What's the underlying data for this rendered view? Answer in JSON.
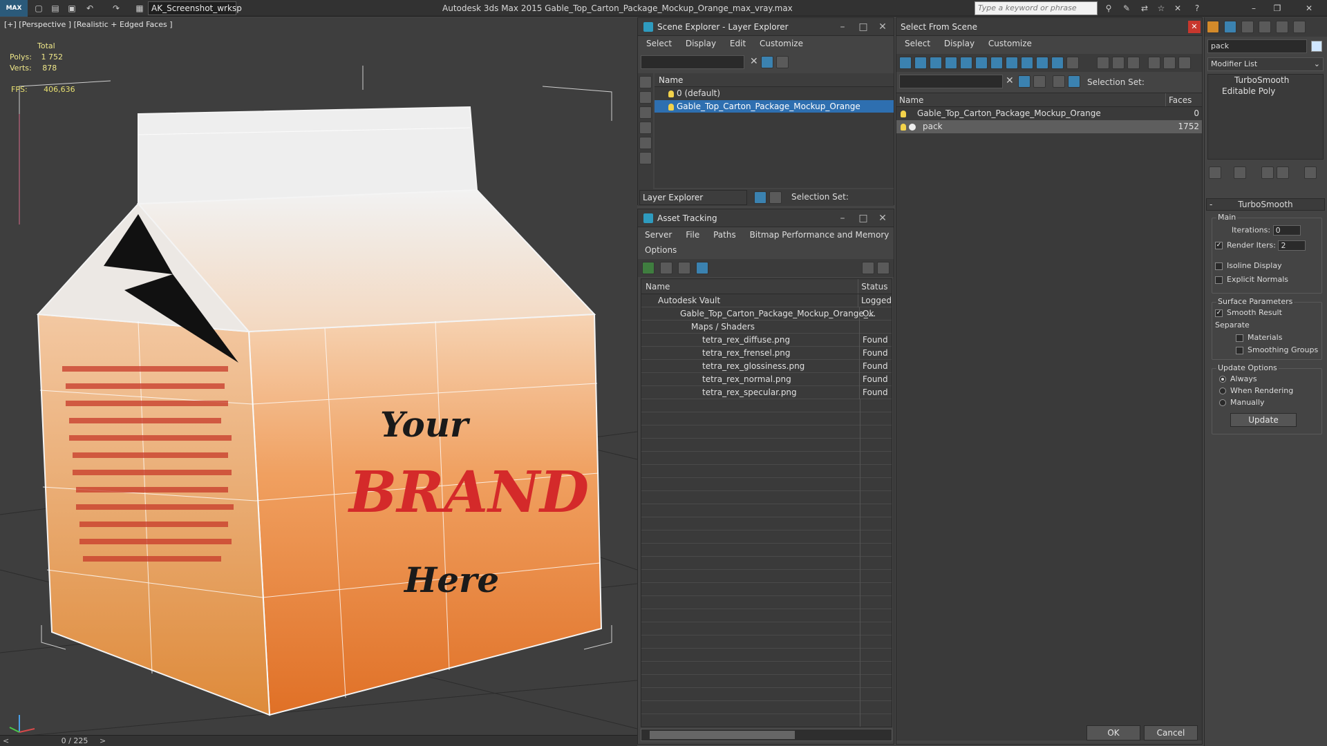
{
  "app": {
    "logo": "MAX",
    "workspace": "AK_Screenshot_wrksp",
    "title": "Autodesk 3ds Max  2015    Gable_Top_Carton_Package_Mockup_Orange_max_vray.max",
    "search_placeholder": "Type a keyword or phrase"
  },
  "viewport": {
    "label": "[+] [Perspective ] [Realistic + Edged Faces ]",
    "stats": {
      "total": "Total",
      "polys_label": "Polys:",
      "polys": "1 752",
      "verts_label": "Verts:",
      "verts": "878"
    },
    "fps_label": "FPS:",
    "fps": "406,636",
    "carton": {
      "line1": "Your",
      "line2": "BRAND",
      "line3": "Here"
    }
  },
  "timeline": {
    "frame": "0 / 225"
  },
  "scene_explorer": {
    "title": "Scene Explorer - Layer Explorer",
    "menu": [
      "Select",
      "Display",
      "Edit",
      "Customize"
    ],
    "col_name": "Name",
    "rows": [
      "0 (default)",
      "Gable_Top_Carton_Package_Mockup_Orange"
    ],
    "footer_dropdown": "Layer Explorer",
    "selection_set": "Selection Set:"
  },
  "asset_tracking": {
    "title": "Asset Tracking",
    "menu": [
      "Server",
      "File",
      "Paths",
      "Bitmap Performance and Memory"
    ],
    "menu2": "Options",
    "col_name": "Name",
    "col_status": "Status",
    "rows": [
      {
        "name": "Autodesk Vault",
        "status": "Logged"
      },
      {
        "name": "Gable_Top_Carton_Package_Mockup_Orange_...",
        "status": "Ok"
      },
      {
        "name": "Maps / Shaders",
        "status": ""
      },
      {
        "name": "tetra_rex_diffuse.png",
        "status": "Found"
      },
      {
        "name": "tetra_rex_frensel.png",
        "status": "Found"
      },
      {
        "name": "tetra_rex_glossiness.png",
        "status": "Found"
      },
      {
        "name": "tetra_rex_normal.png",
        "status": "Found"
      },
      {
        "name": "tetra_rex_specular.png",
        "status": "Found"
      }
    ]
  },
  "select_from_scene": {
    "title": "Select From Scene",
    "menu": [
      "Select",
      "Display",
      "Customize"
    ],
    "selection_set": "Selection Set:",
    "col_name": "Name",
    "col_faces": "Faces",
    "rows": [
      {
        "name": "Gable_Top_Carton_Package_Mockup_Orange",
        "faces": "0"
      },
      {
        "name": "pack",
        "faces": "1752"
      }
    ],
    "ok": "OK",
    "cancel": "Cancel"
  },
  "command_panel": {
    "object_name": "pack",
    "modifier_list": "Modifier List",
    "stack": [
      "TurboSmooth",
      "Editable Poly"
    ],
    "rollout_title": "TurboSmooth",
    "main_group": "Main",
    "iterations_label": "Iterations:",
    "iterations": "0",
    "render_iters_label": "Render Iters:",
    "render_iters": "2",
    "isoline": "Isoline Display",
    "explicit_normals": "Explicit Normals",
    "surface_group": "Surface Parameters",
    "smooth_result": "Smooth Result",
    "separate": "Separate",
    "materials": "Materials",
    "smoothing_groups": "Smoothing Groups",
    "update_group": "Update Options",
    "always": "Always",
    "when_rendering": "When Rendering",
    "manually": "Manually",
    "update_btn": "Update"
  }
}
